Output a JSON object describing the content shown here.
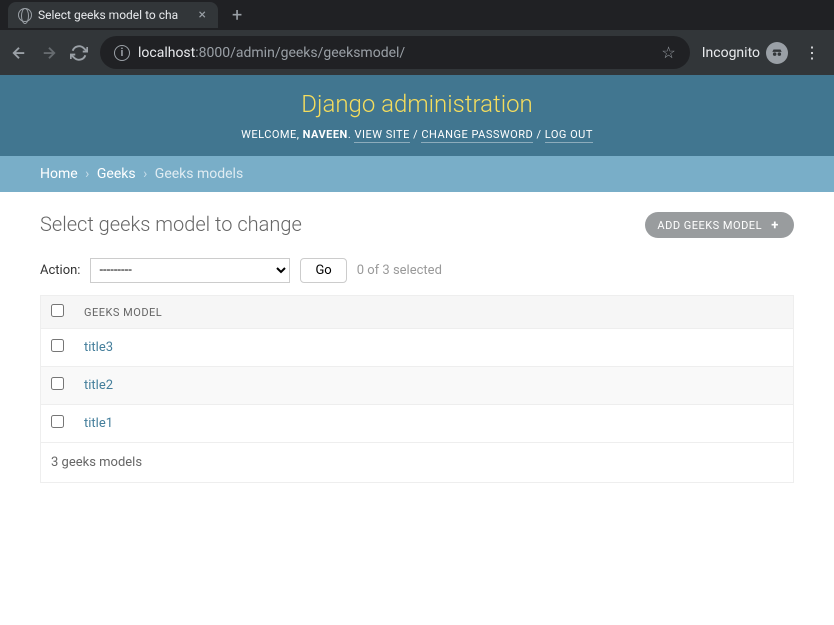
{
  "browser": {
    "tab_title": "Select geeks model to cha",
    "url_host": "localhost",
    "url_path": ":8000/admin/geeks/geeksmodel/",
    "incognito_label": "Incognito"
  },
  "header": {
    "branding": "Django administration",
    "welcome": "WELCOME, ",
    "username": "NAVEEN",
    "view_site": "VIEW SITE",
    "change_password": "CHANGE PASSWORD",
    "logout": "LOG OUT",
    "sep_dot": ". ",
    "sep_slash": " / "
  },
  "breadcrumbs": {
    "home": "Home",
    "app": "Geeks",
    "current": "Geeks models",
    "sep": "›"
  },
  "page": {
    "title": "Select geeks model to change",
    "add_button": "ADD GEEKS MODEL"
  },
  "actions": {
    "label": "Action:",
    "placeholder": "---------",
    "go": "Go",
    "counter": "0 of 3 selected"
  },
  "table": {
    "column_header": "GEEKS MODEL",
    "rows": [
      {
        "title": "title3"
      },
      {
        "title": "title2"
      },
      {
        "title": "title1"
      }
    ]
  },
  "paginator": {
    "summary": "3 geeks models"
  }
}
